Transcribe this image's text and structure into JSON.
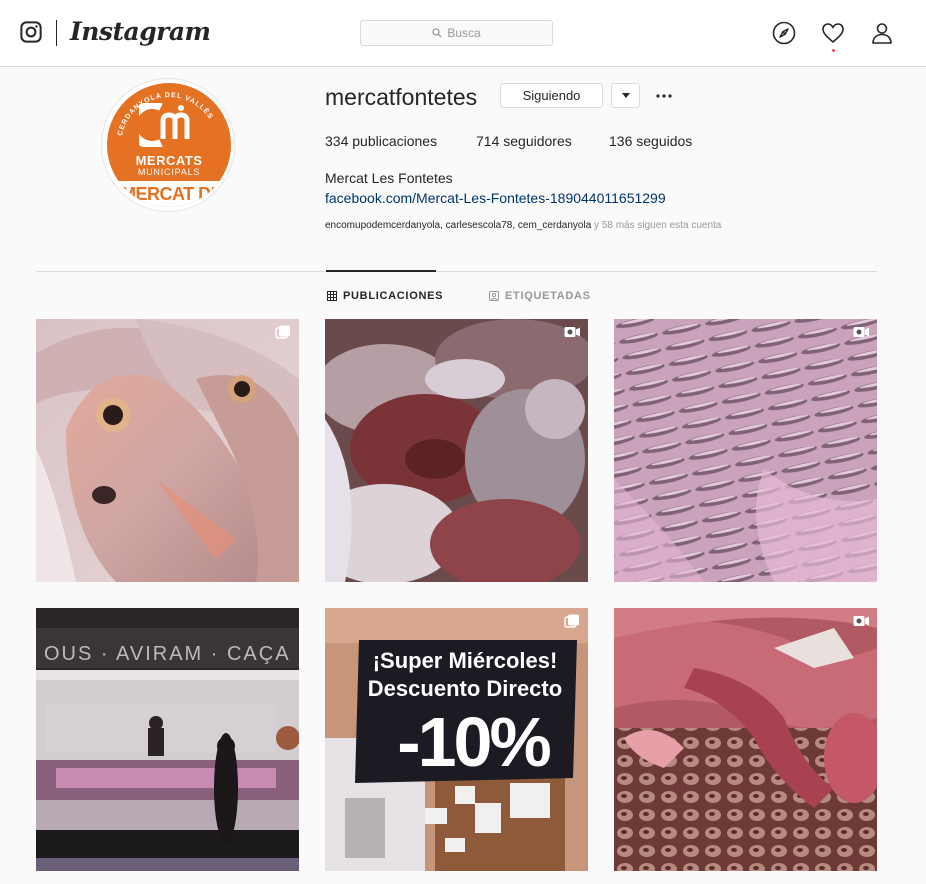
{
  "header": {
    "brand": "Instagram",
    "search_placeholder": "Busca"
  },
  "profile": {
    "username": "mercatfontetes",
    "follow_button": "Siguiendo",
    "stats": {
      "posts": "334 publicaciones",
      "followers": "714 seguidores",
      "following": "136 seguidos"
    },
    "full_name": "Mercat Les Fontetes",
    "link": "facebook.com/Mercat-Les-Fontetes-189044011651299",
    "followed_by_names": "encomupodemcerdanyola, carlesescola78, cem_cerdanyola",
    "followed_by_rest": " y 58 más siguen esta cuenta",
    "avatar_text": {
      "arc": "CERDANYOLA DEL VALLÈS",
      "line1": "MERCATS",
      "line2": "MUNICIPALS",
      "band": "MERCAT DE"
    }
  },
  "tabs": [
    {
      "label": "PUBLICACIONES",
      "active": true
    },
    {
      "label": "ETIQUETADAS",
      "active": false
    }
  ],
  "posts": [
    {
      "subject": "fish",
      "badge": "carousel-icon"
    },
    {
      "subject": "squid",
      "badge": "video-icon"
    },
    {
      "subject": "anchovies",
      "badge": "video-icon"
    },
    {
      "subject": "market-stall",
      "badge": "none"
    },
    {
      "subject": "sign",
      "badge": "carousel-icon",
      "sign_line1": "¡Super Miércoles!",
      "sign_line2": "Descuento Directo",
      "sign_big": "-10%",
      "store_text": "OUS · AVIRAM · CA"
    },
    {
      "subject": "lobsters",
      "badge": "video-icon"
    }
  ],
  "stall_sign": "OUS · AVIRAM · CAÇA",
  "colors": {
    "link": "#003569",
    "accent_orange": "#e57123",
    "notification": "#ed4956"
  }
}
